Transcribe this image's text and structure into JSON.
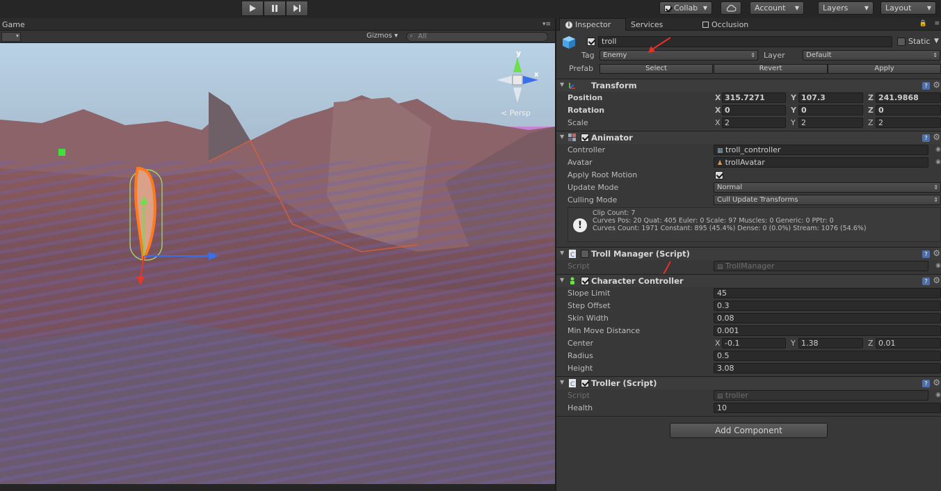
{
  "toolbar": {
    "collab": "Collab",
    "account": "Account",
    "layers": "Layers",
    "layout": "Layout"
  },
  "game": {
    "tab": "Game",
    "gizmos": "Gizmos",
    "search_placeholder": "All",
    "persp": "Persp",
    "gizmo_y": "y",
    "gizmo_x": "x"
  },
  "inspector": {
    "tabs": [
      "Inspector",
      "Services",
      "Occlusion"
    ],
    "object": {
      "active": true,
      "name": "troll",
      "static_label": "Static",
      "tag_label": "Tag",
      "tag": "Enemy",
      "layer_label": "Layer",
      "layer": "Default",
      "prefab_label": "Prefab",
      "prefab_buttons": [
        "Select",
        "Revert",
        "Apply"
      ]
    },
    "transform": {
      "title": "Transform",
      "position_label": "Position",
      "rotation_label": "Rotation",
      "scale_label": "Scale",
      "position": {
        "x": "315.7271",
        "y": "107.3",
        "z": "241.9868"
      },
      "rotation": {
        "x": "0",
        "y": "0",
        "z": "0"
      },
      "scale": {
        "x": "2",
        "y": "2",
        "z": "2"
      }
    },
    "animator": {
      "title": "Animator",
      "enabled": true,
      "controller_label": "Controller",
      "controller": "troll_controller",
      "avatar_label": "Avatar",
      "avatar": "trollAvatar",
      "apply_root_motion_label": "Apply Root Motion",
      "apply_root_motion": true,
      "update_mode_label": "Update Mode",
      "update_mode": "Normal",
      "culling_mode_label": "Culling Mode",
      "culling_mode": "Cull Update Transforms",
      "info": [
        "Clip Count: 7",
        "Curves Pos: 20 Quat: 405 Euler: 0 Scale: 97 Muscles: 0 Generic: 0 PPtr: 0",
        "Curves Count: 1971 Constant: 895 (45.4%) Dense: 0 (0.0%) Stream: 1076 (54.6%)"
      ]
    },
    "troll_manager": {
      "title": "Troll Manager (Script)",
      "enabled": false,
      "script_label": "Script",
      "script": "TrollManager"
    },
    "character_controller": {
      "title": "Character Controller",
      "enabled": true,
      "slope_limit_label": "Slope Limit",
      "slope_limit": "45",
      "step_offset_label": "Step Offset",
      "step_offset": "0.3",
      "skin_width_label": "Skin Width",
      "skin_width": "0.08",
      "min_move_label": "Min Move Distance",
      "min_move": "0.001",
      "center_label": "Center",
      "center": {
        "x": "-0.1",
        "y": "1.38",
        "z": "0.01"
      },
      "radius_label": "Radius",
      "radius": "0.5",
      "height_label": "Height",
      "height": "3.08"
    },
    "troller": {
      "title": "Troller (Script)",
      "enabled": true,
      "script_label": "Script",
      "script": "troller",
      "health_label": "Health",
      "health": "10"
    },
    "add_component": "Add Component"
  },
  "colors": {
    "toolbar_bg": "#262626",
    "panel_bg": "#383838",
    "field_bg": "#2a2a2a",
    "annotation_arrow": "#e8302a"
  }
}
